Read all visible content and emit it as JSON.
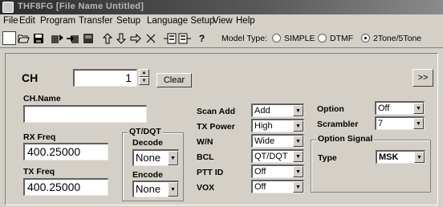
{
  "window": {
    "title": "THF8FG [File Name Untitled]"
  },
  "menu": [
    "File",
    "Edit",
    "Program",
    "Transfer",
    "Setup",
    "Language Setup",
    "View",
    "Help"
  ],
  "toolbar": {
    "model_type_label": "Model Type:",
    "options": [
      {
        "label": "SIMPLE",
        "checked": false
      },
      {
        "label": "DTMF",
        "checked": false
      },
      {
        "label": "2Tone/5Tone",
        "checked": true
      }
    ]
  },
  "channel": {
    "ch_label": "CH",
    "ch_value": "1",
    "clear_label": "Clear",
    "more_label": ">>",
    "name_label": "CH.Name",
    "name_value": "",
    "rx_label": "RX Freq",
    "rx_value": "400.25000",
    "tx_label": "TX Freq",
    "tx_value": "400.25000"
  },
  "qtdqt": {
    "title": "QT/DQT",
    "decode_label": "Decode",
    "decode_value": "None",
    "encode_label": "Encode",
    "encode_value": "None"
  },
  "settings": [
    {
      "label": "Scan Add",
      "value": "Add"
    },
    {
      "label": "TX Power",
      "value": "High"
    },
    {
      "label": "W/N",
      "value": "Wide"
    },
    {
      "label": "BCL",
      "value": "QT/DQT"
    },
    {
      "label": "PTT ID",
      "value": "Off"
    },
    {
      "label": "VOX",
      "value": "Off"
    }
  ],
  "option": {
    "label": "Option",
    "value": "Off"
  },
  "scrambler": {
    "label": "Scrambler",
    "value": "7"
  },
  "option_signal": {
    "title": "Option Signal",
    "type_label": "Type",
    "type_value": "MSK"
  }
}
